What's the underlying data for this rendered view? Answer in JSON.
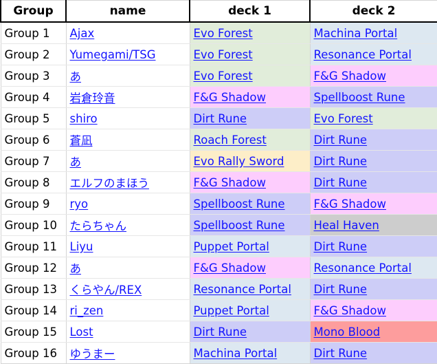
{
  "table": {
    "headers": [
      "Group",
      "name",
      "deck 1",
      "deck 2"
    ],
    "colors": {
      "forest": "#e1edda",
      "portal": "#dde8f1",
      "rune": "#cdcdf7",
      "shadow": "#fdcdfd",
      "sword": "#fdeec8",
      "blood": "#fd9d9d",
      "haven": "#cdcdcd",
      "link_text": "#1414ff",
      "header_text": "#000000",
      "grid_line": "#d4d4d4"
    },
    "rows": [
      {
        "group": "Group 1",
        "name": "Ajax",
        "deck1": "Evo Forest",
        "deck1_color": "forest",
        "deck2": "Machina Portal",
        "deck2_color": "portal"
      },
      {
        "group": "Group 2",
        "name": "Yumegami/TSG",
        "deck1": "Evo Forest",
        "deck1_color": "forest",
        "deck2": "Resonance Portal",
        "deck2_color": "portal"
      },
      {
        "group": "Group 3",
        "name": "あ",
        "deck1": "Evo Forest",
        "deck1_color": "forest",
        "deck2": "F&G Shadow",
        "deck2_color": "shadow"
      },
      {
        "group": "Group 4",
        "name": "岩倉玲音",
        "deck1": "F&G Shadow",
        "deck1_color": "shadow",
        "deck2": "Spellboost Rune",
        "deck2_color": "rune"
      },
      {
        "group": "Group 5",
        "name": "shiro",
        "deck1": "Dirt Rune",
        "deck1_color": "rune",
        "deck2": "Evo Forest",
        "deck2_color": "forest"
      },
      {
        "group": "Group 6",
        "name": "蒼凪",
        "deck1": "Roach Forest",
        "deck1_color": "forest",
        "deck2": "Dirt Rune",
        "deck2_color": "rune"
      },
      {
        "group": "Group 7",
        "name": "あ",
        "deck1": "Evo Rally Sword",
        "deck1_color": "sword",
        "deck2": "Dirt Rune",
        "deck2_color": "rune"
      },
      {
        "group": "Group 8",
        "name": "エルフのまほう",
        "deck1": "F&G Shadow",
        "deck1_color": "shadow",
        "deck2": "Dirt Rune",
        "deck2_color": "rune"
      },
      {
        "group": "Group 9",
        "name": "ryo",
        "deck1": "Spellboost Rune",
        "deck1_color": "rune",
        "deck2": "F&G Shadow",
        "deck2_color": "shadow"
      },
      {
        "group": "Group 10",
        "name": "たらちゃん",
        "deck1": "Spellboost Rune",
        "deck1_color": "rune",
        "deck2": "Heal Haven",
        "deck2_color": "haven"
      },
      {
        "group": "Group 11",
        "name": "Liyu",
        "deck1": "Puppet Portal",
        "deck1_color": "portal",
        "deck2": "Dirt Rune",
        "deck2_color": "rune"
      },
      {
        "group": "Group 12",
        "name": "あ",
        "deck1": "F&G Shadow",
        "deck1_color": "shadow",
        "deck2": "Resonance Portal",
        "deck2_color": "portal"
      },
      {
        "group": "Group 13",
        "name": "くらやん/REX",
        "deck1": "Resonance Portal",
        "deck1_color": "portal",
        "deck2": "Dirt Rune",
        "deck2_color": "rune"
      },
      {
        "group": "Group 14",
        "name": "ri_zen",
        "deck1": "Puppet Portal",
        "deck1_color": "portal",
        "deck2": "F&G Shadow",
        "deck2_color": "shadow"
      },
      {
        "group": "Group 15",
        "name": "Lost",
        "deck1": "Dirt Rune",
        "deck1_color": "rune",
        "deck2": "Mono Blood",
        "deck2_color": "blood"
      },
      {
        "group": "Group 16",
        "name": "ゆうまー",
        "deck1": "Machina Portal",
        "deck1_color": "portal",
        "deck2": "Dirt Rune",
        "deck2_color": "rune"
      }
    ]
  }
}
